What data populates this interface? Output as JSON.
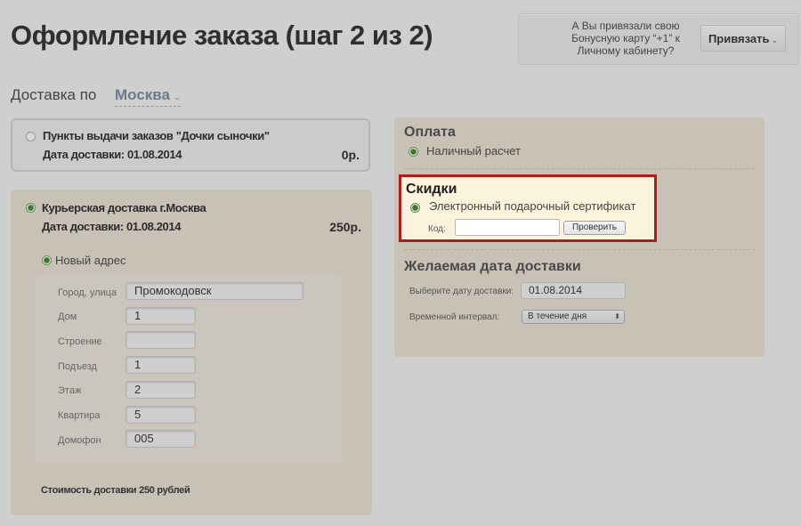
{
  "header": {
    "title": "Оформление заказа (шаг 2 из 2)",
    "bonus_prompt": "А Вы привязали свою Бонусную карту “+1” к Личному кабинету?",
    "bind_button_label": "Привязать"
  },
  "delivery": {
    "label": "Доставка по",
    "city": "Москва",
    "options": [
      {
        "title": "Пункты выдачи заказов \"Дочки сыночки\"",
        "date_label": "Дата доставки: 01.08.2014",
        "price": "0р.",
        "selected": false
      },
      {
        "title": "Курьерская доставка г.Москва",
        "date_label": "Дата доставки: 01.08.2014",
        "price": "250р.",
        "selected": true
      }
    ],
    "new_address_label": "Новый адрес",
    "address_fields": [
      {
        "label": "Город, улица",
        "value": "Промокодовск"
      },
      {
        "label": "Дом",
        "value": "1"
      },
      {
        "label": "Строение",
        "value": ""
      },
      {
        "label": "Подъезд",
        "value": "1"
      },
      {
        "label": "Этаж",
        "value": "2"
      },
      {
        "label": "Квартира",
        "value": "5"
      },
      {
        "label": "Домофон",
        "value": "005"
      }
    ],
    "cost_note": "Стоимость доставки 250 рублей"
  },
  "payment": {
    "title": "Оплата",
    "option": "Наличный расчет"
  },
  "discounts": {
    "title": "Скидки",
    "option": "Электронный подарочный сертификат",
    "code_label": "Код:",
    "code_value": "",
    "check_button_label": "Проверить"
  },
  "desired_date": {
    "title": "Желаемая дата доставки",
    "date_label": "Выберите дату доставки:",
    "date_value": "01.08.2014",
    "interval_label": "Временной интервал:",
    "interval_value": "В течение дня"
  },
  "colors": {
    "highlight_border": "#b51a1a",
    "highlight_fill": "#fbf3dc",
    "panel": "#c7c1b6",
    "city_link": "#6b7b8c"
  }
}
